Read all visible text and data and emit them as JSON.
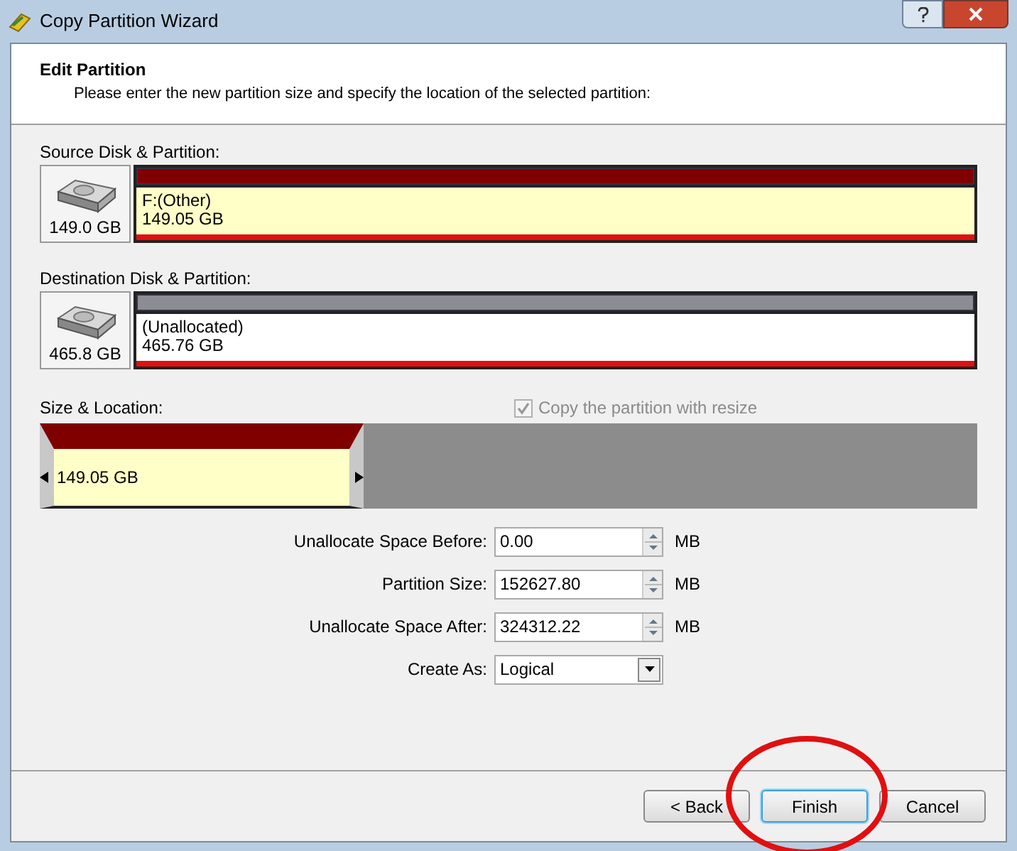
{
  "window": {
    "title": "Copy Partition Wizard"
  },
  "header": {
    "title": "Edit Partition",
    "subtitle": "Please enter the new partition size and specify the location of the selected partition:"
  },
  "disks": [
    {
      "label": "Source Disk & Partition:",
      "disk_size": "149.0 GB",
      "partition": {
        "kind": "used",
        "name": "F:(Other)",
        "size": "149.05 GB"
      }
    },
    {
      "label": "Destination Disk & Partition:",
      "disk_size": "465.8 GB",
      "partition": {
        "kind": "unallocated",
        "name": "(Unallocated)",
        "size": "465.76 GB"
      }
    }
  ],
  "size_location": {
    "label": "Size & Location:",
    "copy_with_resize": {
      "label": "Copy the partition with resize",
      "checked": true,
      "disabled": true
    },
    "partition_size": "149.05 GB",
    "level": 0.345
  },
  "fields": [
    {
      "kind": "spin",
      "label": "Unallocate Space Before:",
      "value": "0.00",
      "unit": "MB"
    },
    {
      "kind": "spin",
      "label": "Partition Size:",
      "value": "152627.80",
      "unit": "MB"
    },
    {
      "kind": "spin",
      "label": "Unallocate Space After:",
      "value": "324312.22",
      "unit": "MB"
    },
    {
      "kind": "dropdown",
      "label": "Create As:",
      "value": "Logical"
    }
  ],
  "buttons": [
    {
      "label": "< Back",
      "default": false
    },
    {
      "label": "Finish",
      "default": true
    },
    {
      "label": "Cancel",
      "default": false
    }
  ]
}
